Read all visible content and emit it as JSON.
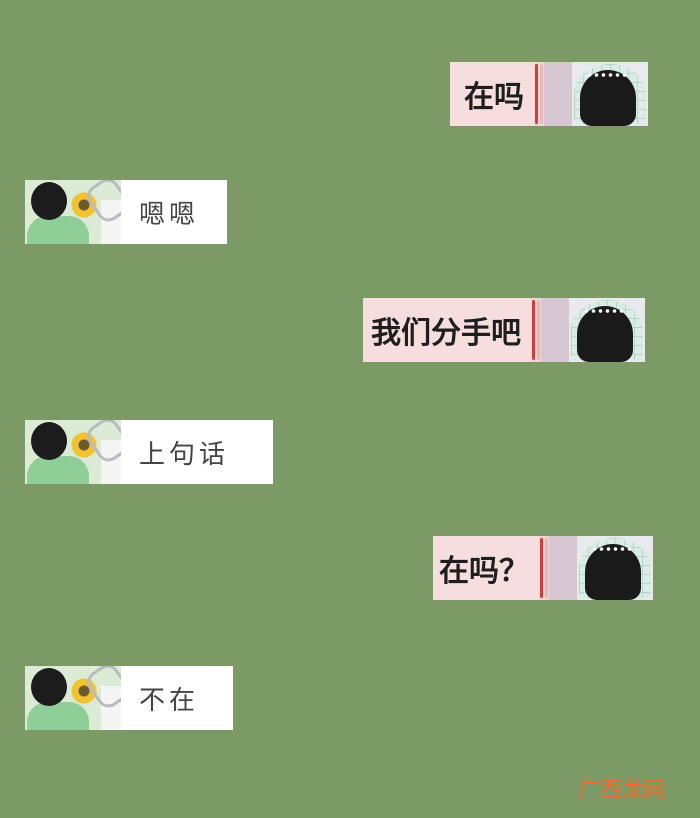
{
  "conversation": {
    "messages": [
      {
        "id": "m1",
        "side": "right",
        "text": "在吗"
      },
      {
        "id": "m2",
        "side": "left",
        "text": "嗯嗯"
      },
      {
        "id": "m3",
        "side": "right",
        "text": "我们分手吧"
      },
      {
        "id": "m4",
        "side": "left",
        "text": "上句话"
      },
      {
        "id": "m5",
        "side": "right",
        "text": "在吗？"
      },
      {
        "id": "m6",
        "side": "left",
        "text": "不在"
      }
    ]
  },
  "watermark": {
    "text": "广西龙网"
  }
}
